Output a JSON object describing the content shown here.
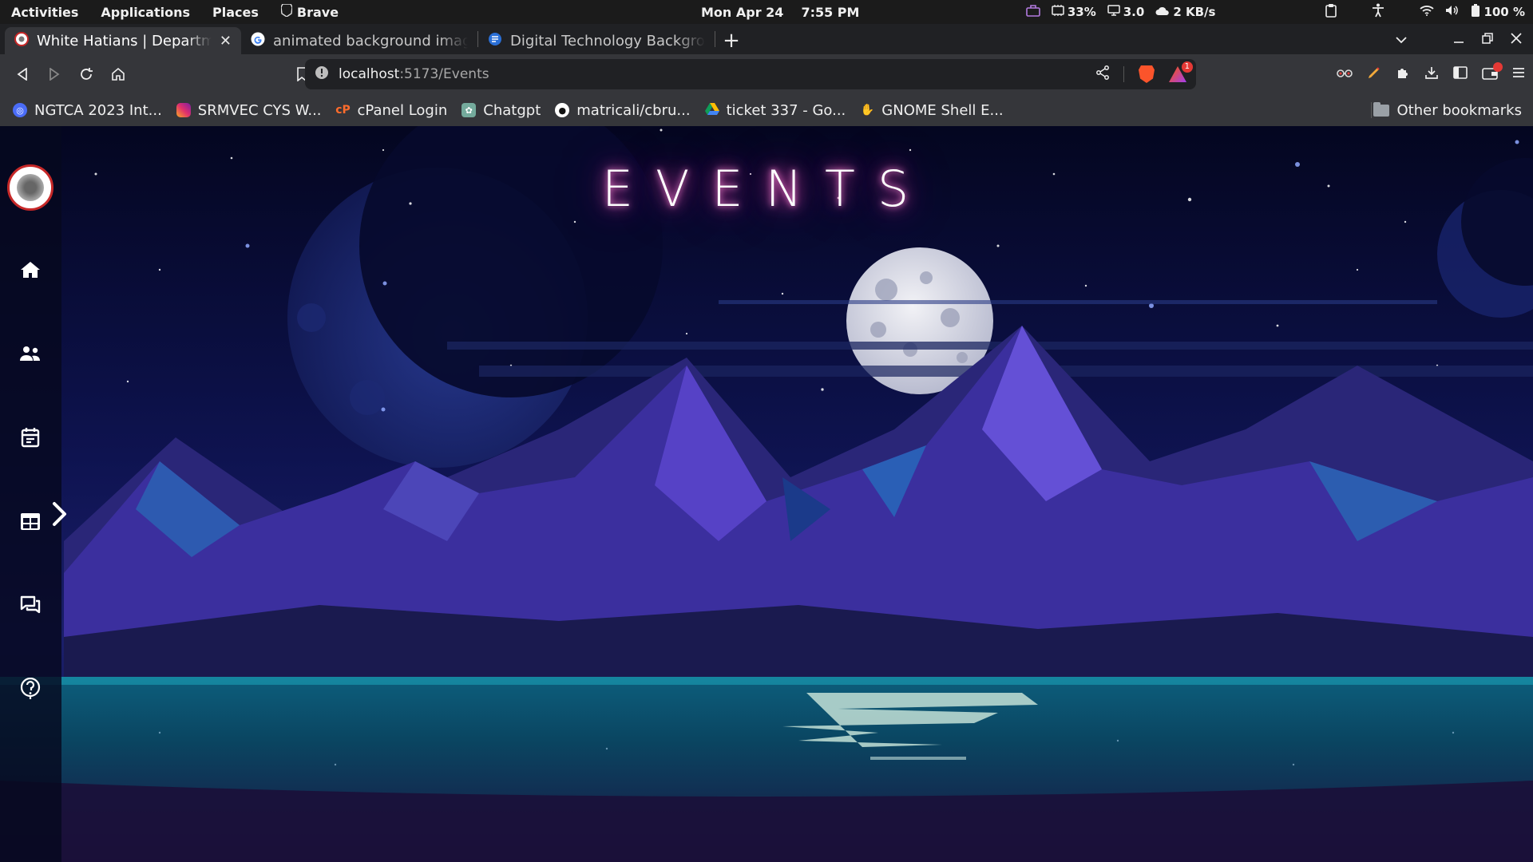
{
  "topbar": {
    "activities": "Activities",
    "applications": "Applications",
    "places": "Places",
    "brave": "Brave",
    "date": "Mon Apr 24",
    "time": "7:55 PM",
    "cpu": "33%",
    "load": "3.0",
    "net": "2 KB/s",
    "battery": "100 %"
  },
  "tabs": [
    {
      "title": "White Hatians | Department",
      "active": true
    },
    {
      "title": "animated background images",
      "active": false
    },
    {
      "title": "Digital Technology Background",
      "active": false
    }
  ],
  "toolbar": {
    "url_host": "localhost",
    "url_path": ":5173/Events",
    "rewards_badge": "1"
  },
  "bookmarks": [
    {
      "label": "NGTCA 2023 Int...",
      "icon_color": "#4a6cf7"
    },
    {
      "label": "SRMVEC CYS W...",
      "icon_color": "#e1306c"
    },
    {
      "label": "cPanel Login",
      "icon_color": "#ff6c2c"
    },
    {
      "label": "Chatgpt",
      "icon_color": "#74aa9c"
    },
    {
      "label": "matricali/cbru...",
      "icon_color": "#ffffff"
    },
    {
      "label": "ticket 337 - Go...",
      "icon_color": "#fbbc04"
    },
    {
      "label": "GNOME Shell E...",
      "icon_color": "#cccccc"
    }
  ],
  "other_bookmarks": "Other bookmarks",
  "page": {
    "heading": "EVENTS",
    "sidebar_icons": [
      "home-icon",
      "people-icon",
      "event-icon",
      "calendar-icon",
      "chat-icon",
      "help-icon"
    ]
  },
  "colors": {
    "sky_top": "#050826",
    "sky_mid": "#151a5c",
    "mountain_purple": "#4a32b0",
    "water": "#0f6c84",
    "glow": "#ff4fc0"
  }
}
